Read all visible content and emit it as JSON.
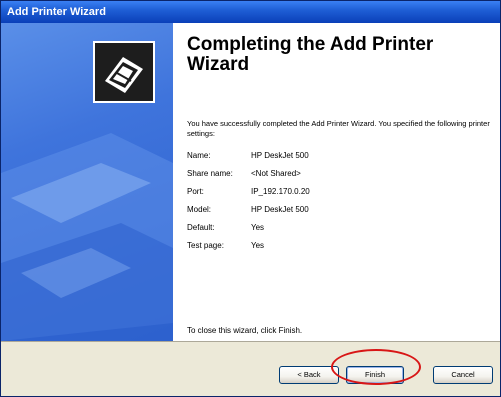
{
  "window": {
    "title": "Add Printer Wizard"
  },
  "colors": {
    "title_bar": "#0a3fb8",
    "left_pane": "#3f74dc",
    "highlight": "#d81616"
  },
  "content": {
    "heading": "Completing the Add Printer Wizard",
    "intro": "You have successfully completed the Add Printer Wizard. You specified the following printer settings:",
    "settings": [
      {
        "label": "Name:",
        "value": "HP DeskJet 500"
      },
      {
        "label": "Share name:",
        "value": "<Not Shared>"
      },
      {
        "label": "Port:",
        "value": "IP_192.170.0.20"
      },
      {
        "label": "Model:",
        "value": "HP DeskJet 500"
      },
      {
        "label": "Default:",
        "value": "Yes"
      },
      {
        "label": "Test page:",
        "value": "Yes"
      }
    ],
    "close_note": "To close this wizard, click Finish."
  },
  "buttons": {
    "back": "< Back",
    "finish": "Finish",
    "cancel": "Cancel"
  },
  "icons": {
    "wizard_logo": "printer-icon"
  }
}
